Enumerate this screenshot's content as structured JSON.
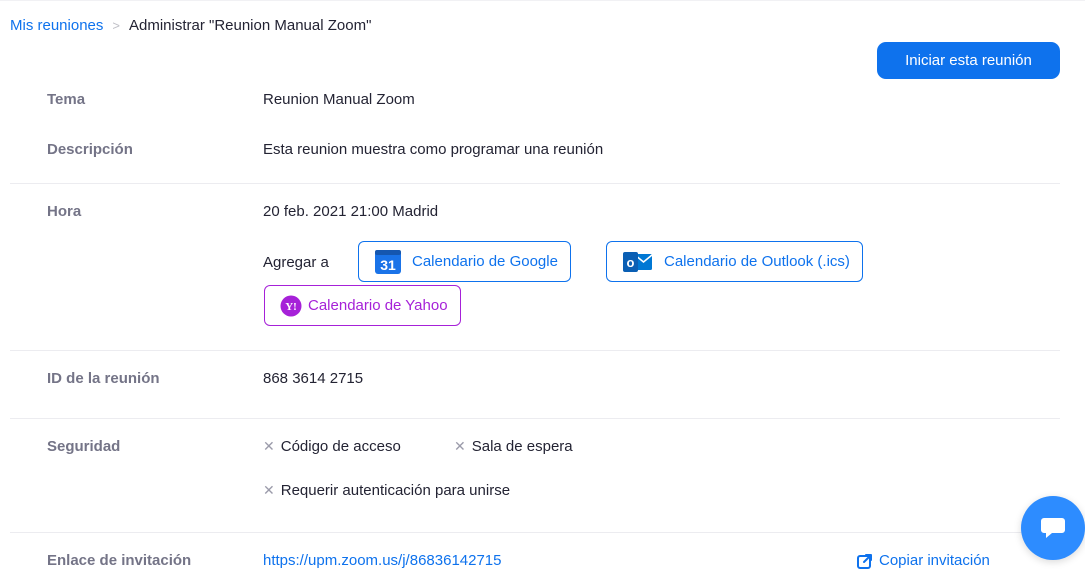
{
  "breadcrumb": {
    "root": "Mis reuniones",
    "separator": ">",
    "current": "Administrar \"Reunion Manual Zoom\""
  },
  "actions": {
    "start_meeting": "Iniciar esta reunión"
  },
  "fields": {
    "topic": {
      "label": "Tema",
      "value": "Reunion Manual Zoom"
    },
    "description": {
      "label": "Descripción",
      "value": "Esta reunion muestra como programar una reunión"
    },
    "time": {
      "label": "Hora",
      "value": "20 feb. 2021 21:00 Madrid"
    },
    "meeting_id": {
      "label": "ID de la reunión",
      "value": "868 3614 2715"
    },
    "security": {
      "label": "Seguridad"
    },
    "invite": {
      "label": "Enlace de invitación"
    }
  },
  "calendar": {
    "add_to_label": "Agregar a",
    "google": {
      "label": "Calendario de Google",
      "icon": "google-calendar-icon",
      "icon_text": "31"
    },
    "outlook": {
      "label": "Calendario de Outlook (.ics)",
      "icon": "outlook-icon",
      "icon_text": "o"
    },
    "yahoo": {
      "label": "Calendario de Yahoo",
      "icon": "yahoo-icon",
      "icon_text": "Y!"
    }
  },
  "security_options": [
    {
      "label": "Código de acceso",
      "enabled": false
    },
    {
      "label": "Sala de espera",
      "enabled": false
    },
    {
      "label": "Requerir autenticación para unirse",
      "enabled": false
    }
  ],
  "invite": {
    "url": "https://upm.zoom.us/j/86836142715",
    "copy_label": "Copiar invitación"
  },
  "colors": {
    "accent": "#0e72ed",
    "yahoo": "#a621d8",
    "label_gray": "#747487",
    "chat_fab": "#2d8cff"
  }
}
